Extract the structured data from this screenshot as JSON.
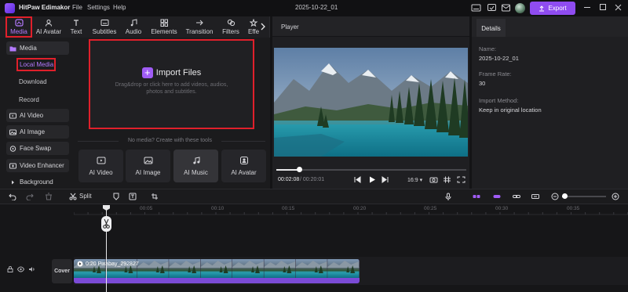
{
  "app": {
    "title": "HitPaw Edimakor",
    "menu": [
      "File",
      "Settings",
      "Help"
    ],
    "project_name": "2025-10-22_01",
    "export_label": "Export"
  },
  "toolbar": {
    "tabs": [
      {
        "label": "Media",
        "icon": "media-icon",
        "active": true
      },
      {
        "label": "AI Avatar",
        "icon": "ai-avatar-icon"
      },
      {
        "label": "Text",
        "icon": "text-icon"
      },
      {
        "label": "Subtitles",
        "icon": "subtitles-icon"
      },
      {
        "label": "Audio",
        "icon": "audio-icon"
      },
      {
        "label": "Elements",
        "icon": "elements-icon"
      },
      {
        "label": "Transition",
        "icon": "transition-icon"
      },
      {
        "label": "Filters",
        "icon": "filters-icon"
      },
      {
        "label": "Effe",
        "icon": "effects-icon"
      }
    ]
  },
  "sidebar": {
    "media": "Media",
    "local_media": "Local Media",
    "download": "Download",
    "record": "Record",
    "ai_video": "AI Video",
    "ai_image": "AI Image",
    "face_swap": "Face Swap",
    "video_enhancer": "Video Enhancer",
    "background": "Background"
  },
  "media_area": {
    "import_label": "Import Files",
    "import_hint": "Drag&drop or click here to add videos, audios, photos and subtitles.",
    "no_media_text": "No media? Create with these tools",
    "ai_tools": [
      "AI Video",
      "AI Image",
      "AI Music",
      "AI Avatar"
    ]
  },
  "player": {
    "title": "Player",
    "time_current": "00:02:08",
    "time_total": "/ 00:20:01",
    "aspect_ratio": "16:9",
    "progress": 0.11
  },
  "details": {
    "tab": "Details",
    "name_label": "Name:",
    "name_value": "2025-10-22_01",
    "frame_rate_label": "Frame Rate:",
    "frame_rate_value": "30",
    "import_method_label": "Import Method:",
    "import_method_value": "Keep in original location"
  },
  "timeline": {
    "split_label": "Split",
    "ruler_ticks": [
      "00:05",
      "00:10",
      "00:15",
      "00:20",
      "00:25",
      "00:30",
      "00:35"
    ],
    "cover_label": "Cover",
    "clip_label": "0:20 Pixabay_292827"
  },
  "colors": {
    "accent": "#8f4cf0",
    "highlight_box": "#e0202b",
    "clip_bar": "#7b4bd6"
  }
}
